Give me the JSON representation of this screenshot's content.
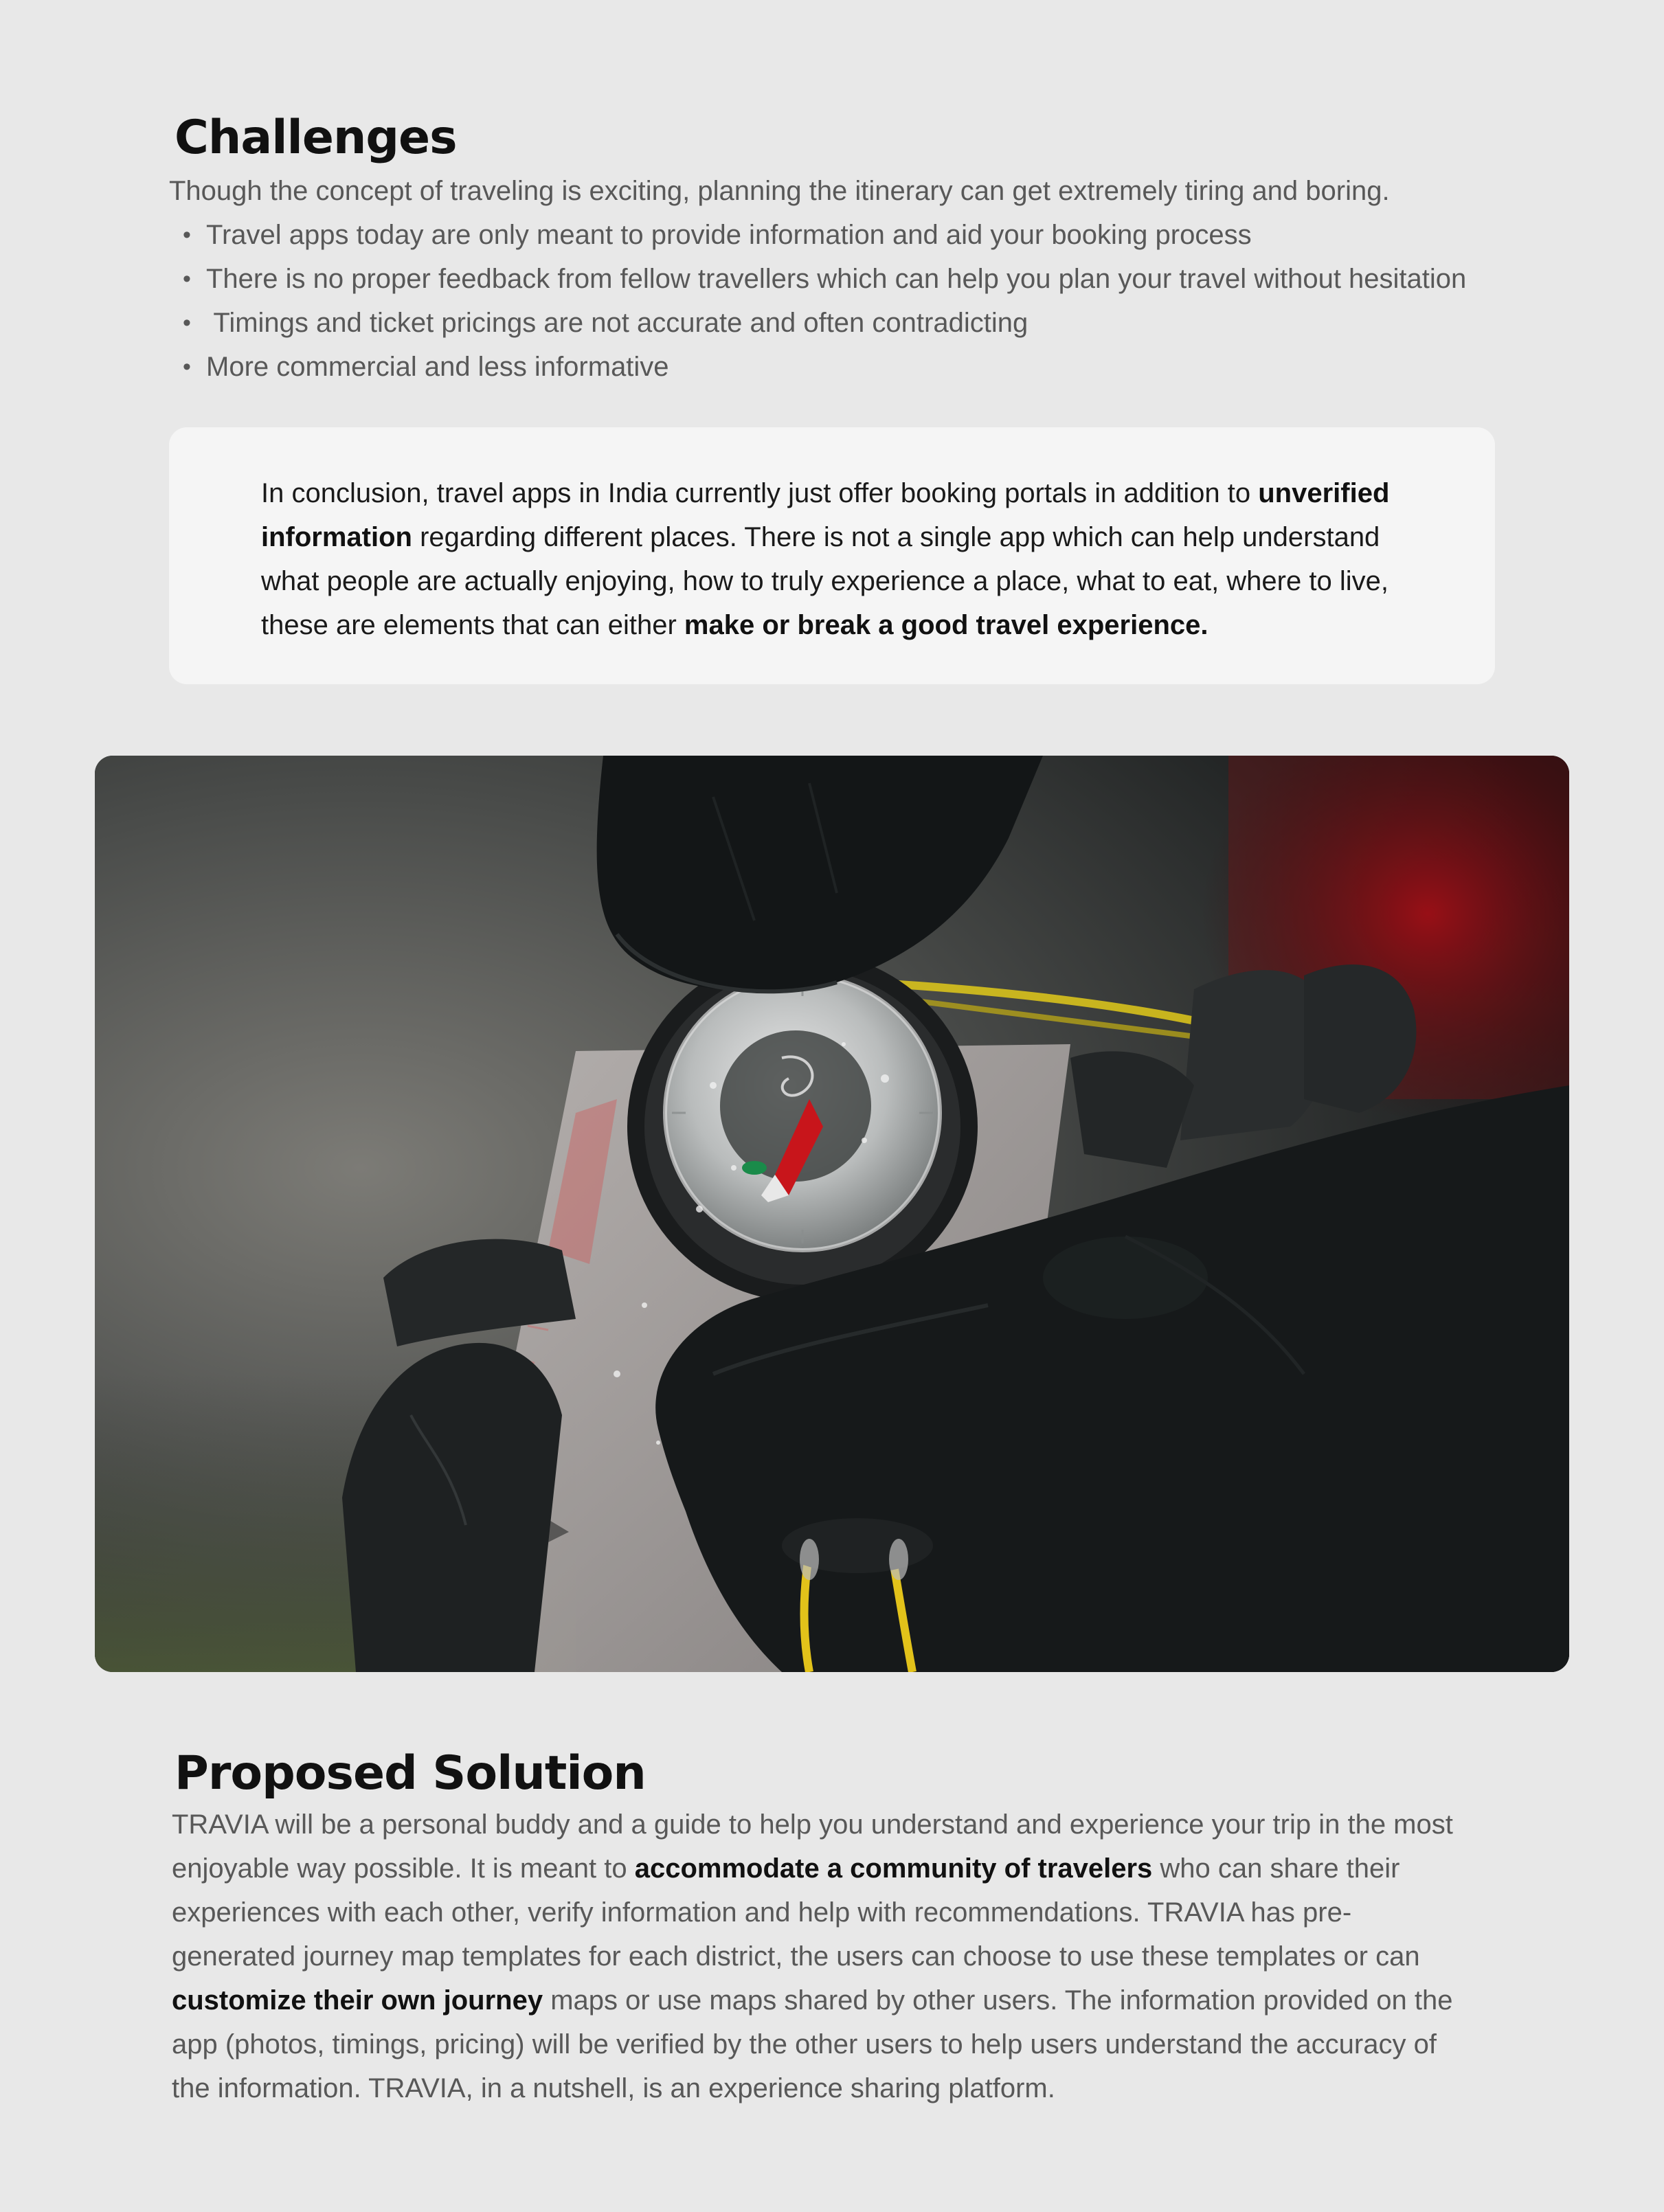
{
  "challenges": {
    "title": "Challenges",
    "intro": "Though the concept of traveling is exciting, planning the itinerary can get extremely tiring and boring.",
    "bullet_marker": "•",
    "bullets": [
      "Travel apps today are only meant to provide information and aid your booking process",
      "There is no proper feedback from fellow travellers which can help you plan your travel without hesitation",
      " Timings and ticket pricings are not accurate and often contradicting",
      "More commercial and less informative"
    ]
  },
  "conclusion": {
    "part1": "In conclusion, travel apps in India currently just offer booking portals in addition to ",
    "bold1": "unverified information",
    "part2": " regarding different places. There is not a single app which can help understand what people are actually enjoying, how to truly experience a place, what to eat, where to live, these are elements that can either ",
    "bold2": "make or break a good travel experience."
  },
  "photo": {
    "icon": "compass-photo",
    "colors": {
      "glove": "#16191a",
      "compass_red": "#c8151b",
      "cord": "#d8c21c",
      "background_red": "#7a0d12"
    }
  },
  "solution": {
    "title": "Proposed Solution",
    "part1": "TRAVIA will be a personal buddy and a guide to help you understand and experience your trip in the most enjoyable way possible. It is meant to ",
    "bold1": "accommodate a community of travelers",
    "part2": " who can share their experiences with each other, verify information and help with recommendations. TRAVIA has pre-generated journey map templates for each district, the users can choose to use these templates or can ",
    "bold2": "customize their own journey",
    "part3": " maps or use maps shared by other users. The information provided on the app (photos, timings, pricing) will be verified by the other users to help users understand the accuracy of the information. TRAVIA, in a nutshell, is an experience sharing platform."
  }
}
